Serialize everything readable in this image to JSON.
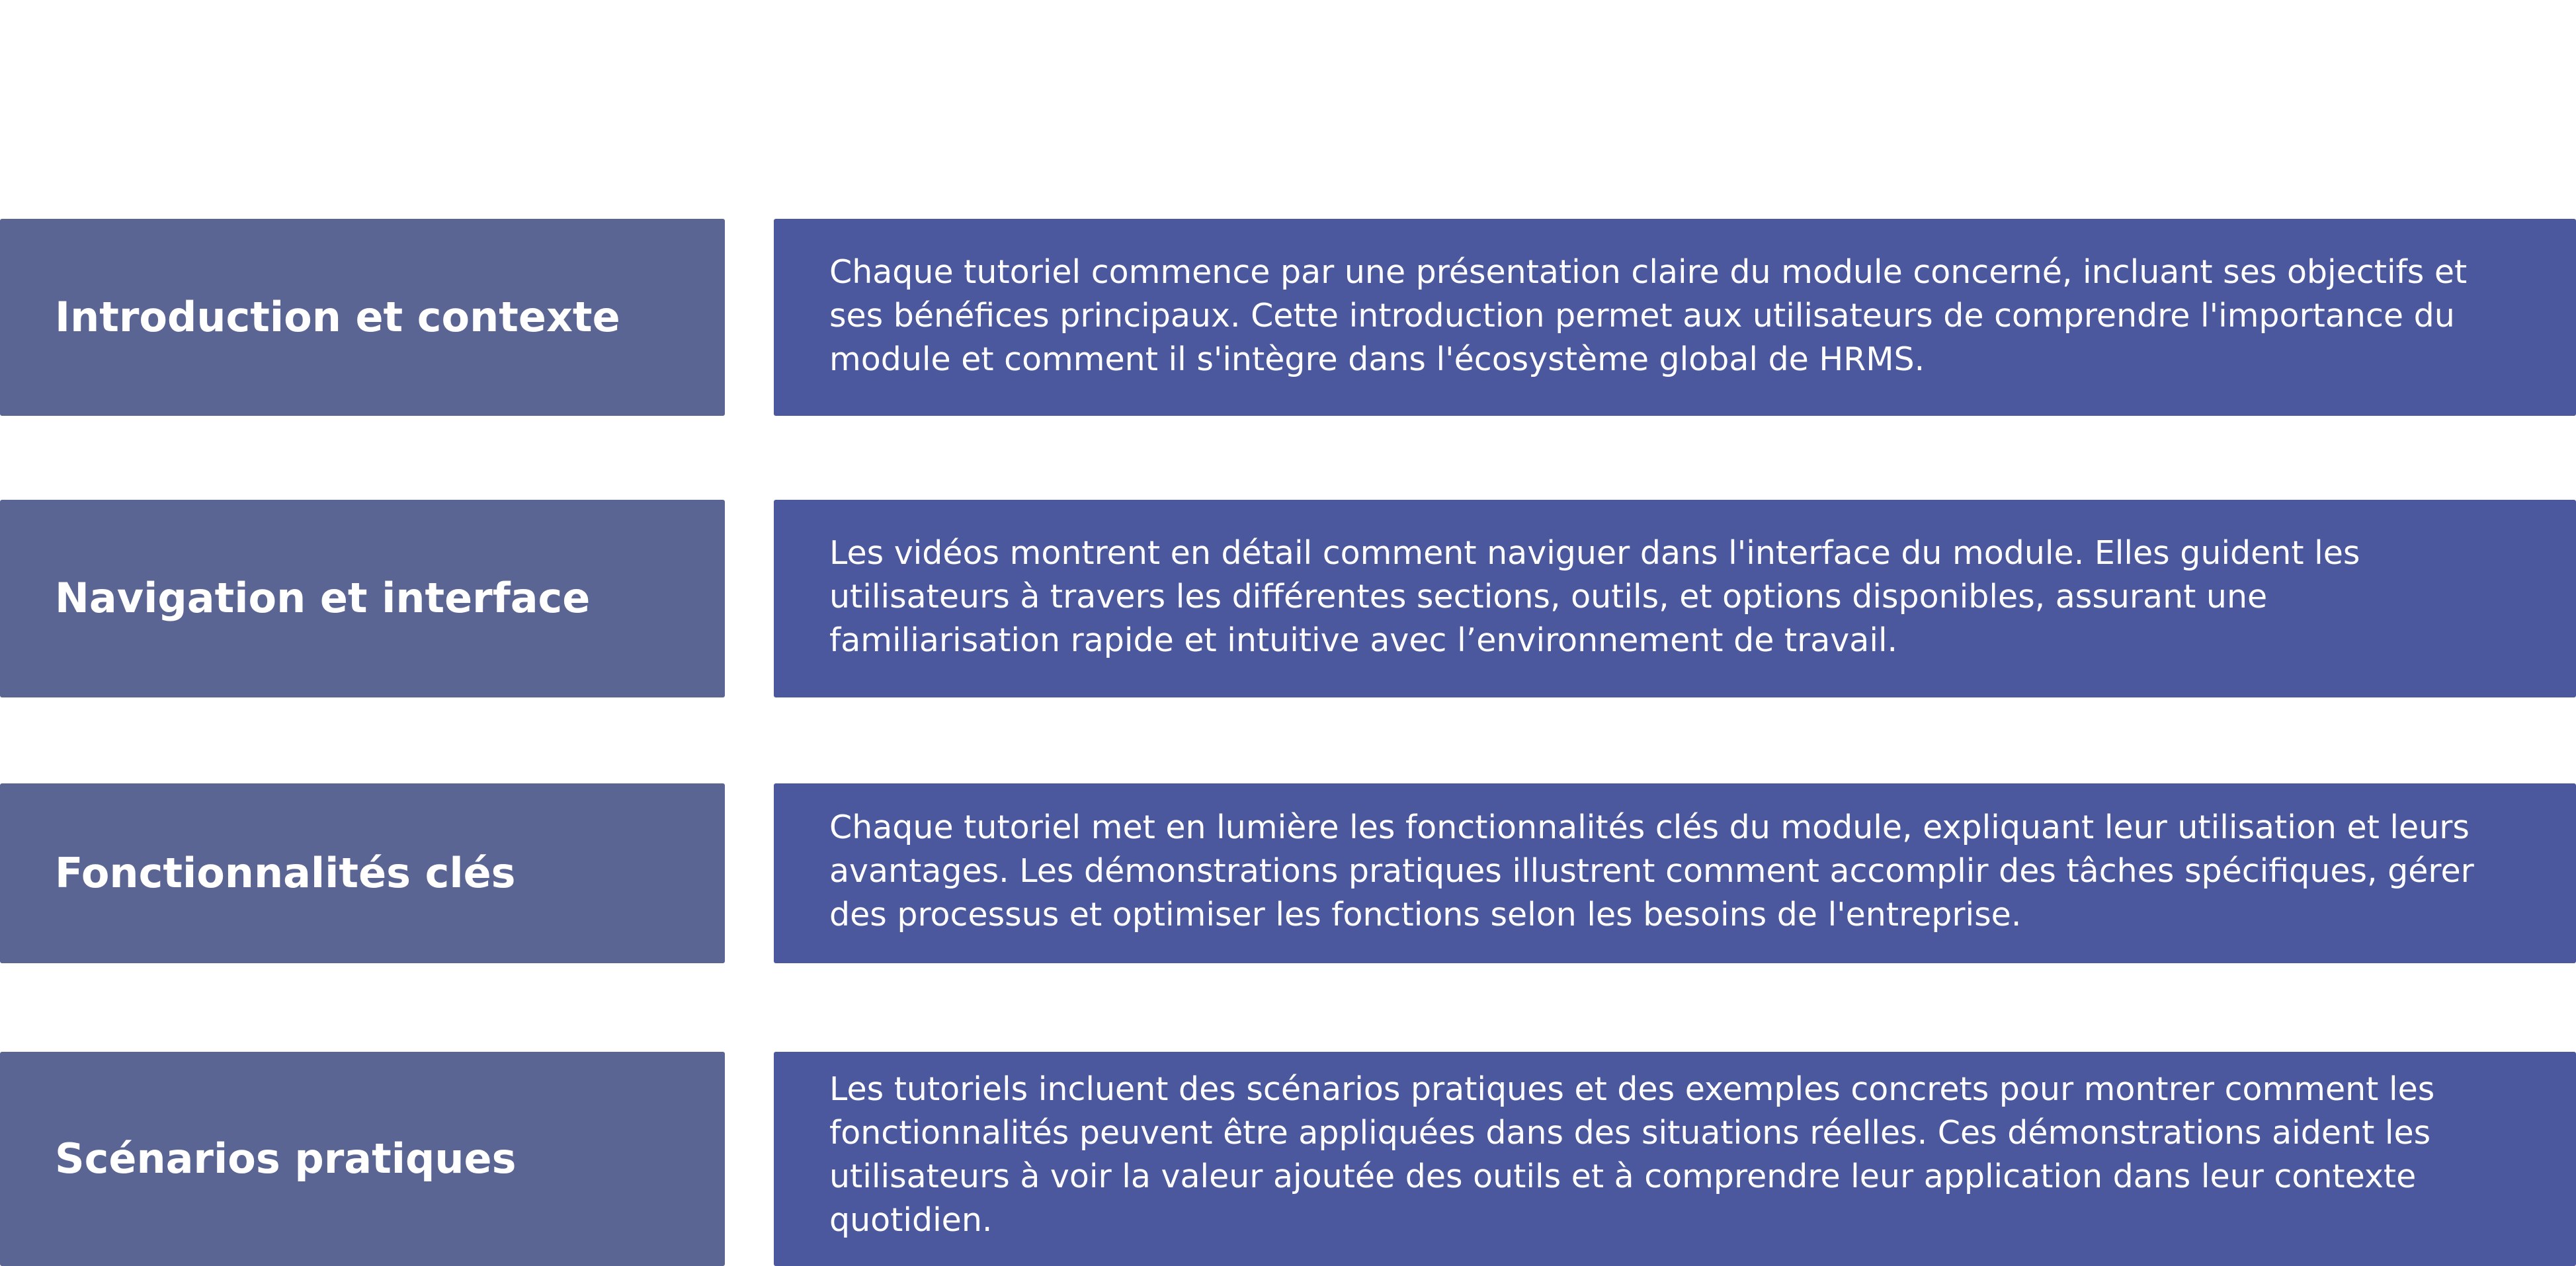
{
  "sections": [
    {
      "title": "Introduction et contexte",
      "description": "Chaque tutoriel commence par une présentation claire du module concerné, incluant ses objectifs et ses bénéfices principaux. Cette introduction permet aux utilisateurs de comprendre l'importance du module et comment il s'intègre dans l'écosystème global de HRMS."
    },
    {
      "title": "Navigation et interface",
      "description": "Les vidéos montrent en détail comment naviguer dans l'interface du module. Elles guident les utilisateurs à travers les différentes sections, outils, et options disponibles, assurant une familiarisation rapide et intuitive avec l’environnement de travail."
    },
    {
      "title": "Fonctionnalités clés",
      "description": "Chaque tutoriel met en lumière les fonctionnalités clés du module, expliquant leur utilisation et leurs avantages. Les démonstrations pratiques illustrent comment accomplir des tâches spécifiques, gérer des processus et optimiser les fonctions selon les besoins de l'entreprise."
    },
    {
      "title": "Scénarios pratiques",
      "description": "Les tutoriels incluent des scénarios pratiques et des exemples concrets pour montrer comment les fonctionnalités peuvent être appliquées dans des situations réelles. Ces démonstrations aident les utilisateurs à voir la valeur ajoutée des outils et à comprendre leur application dans leur contexte quotidien."
    }
  ]
}
